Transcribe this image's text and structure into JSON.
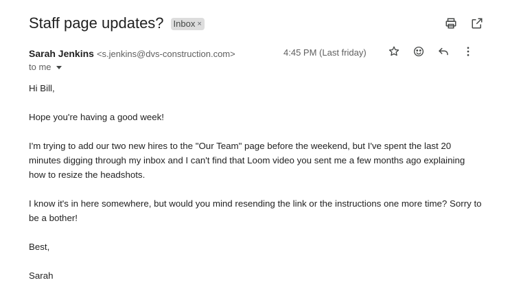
{
  "subject": "Staff page updates?",
  "label": {
    "text": "Inbox",
    "close": "×"
  },
  "toolbar": {
    "print_icon": "print-icon",
    "popout_icon": "open-in-new-window-icon"
  },
  "sender": {
    "name": "Sarah Jenkins",
    "email": "<s.jenkins@dvs-construction.com>",
    "time": "4:45 PM (Last friday)"
  },
  "message_actions": {
    "star_icon": "star-icon",
    "emoji_icon": "emoji-icon",
    "reply_icon": "reply-icon",
    "more_icon": "more-vertical-icon"
  },
  "recipient": {
    "text": "to me"
  },
  "body": {
    "greeting": "Hi Bill,",
    "p1": "Hope you're having a good week!",
    "p2": "I'm trying to add our two new hires to the \"Our Team\" page before the weekend, but I've spent the last 20 minutes digging through my inbox and I can't find that Loom video you sent me a few months ago explaining how to resize the headshots.",
    "p3": "I know it's in here somewhere, but would you mind resending the link or the instructions one more time? Sorry to be a bother!",
    "signoff": "Best,",
    "signature": "Sarah"
  },
  "colors": {
    "text": "#202124",
    "muted": "#5e5e5e",
    "chip_bg": "#dddddd"
  }
}
